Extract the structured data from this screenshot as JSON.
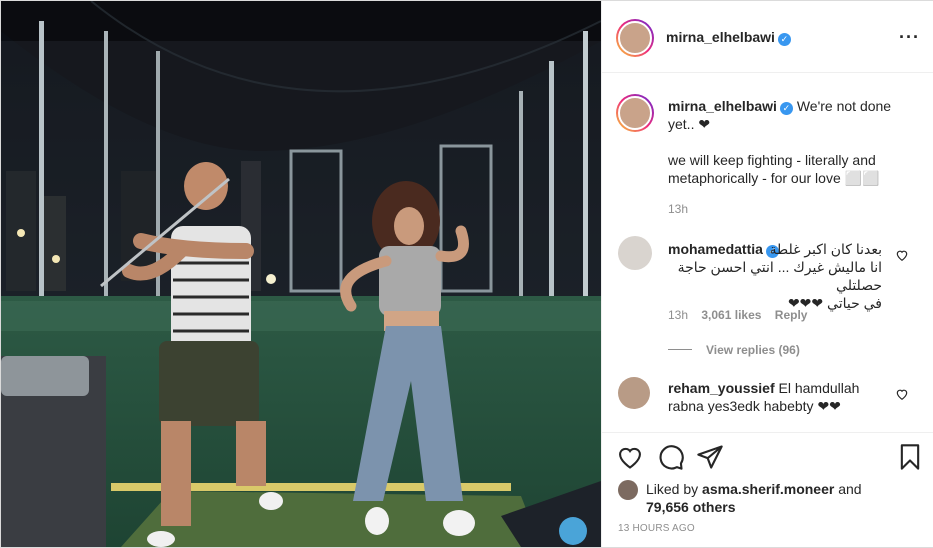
{
  "post": {
    "author": "mirna_elhelbawi",
    "verified": true,
    "more_icon": "more-options-icon"
  },
  "caption": {
    "author": "mirna_elhelbawi",
    "line1": "We're not done",
    "line2": "yet.. ❤",
    "line3": "we will keep fighting - literally and",
    "line4": "metaphorically - for our love ⬜⬜",
    "time": "13h"
  },
  "comments": [
    {
      "author": "mohamedattia",
      "line1": "بعدنا كان اكبر غلطة",
      "line2": "انا ماليش غيرك ... انتي احسن حاجة حصلتلي",
      "line3": "في حياتي ❤❤❤",
      "time": "13h",
      "likes": "3,061 likes",
      "reply": "Reply",
      "view_replies": "View replies (96)"
    },
    {
      "author": "reham_youssief",
      "line1": "El hamdullah",
      "line2": "rabna yes3edk habebty ❤❤"
    }
  ],
  "actions": {
    "like_icon": "heart-icon",
    "comment_icon": "comment-icon",
    "share_icon": "share-icon",
    "save_icon": "bookmark-icon"
  },
  "likes": {
    "prefix": "Liked by",
    "user": "asma.sherif.moneer",
    "and": "and",
    "count": "79,656 others"
  },
  "timestamp": "13 HOURS AGO"
}
